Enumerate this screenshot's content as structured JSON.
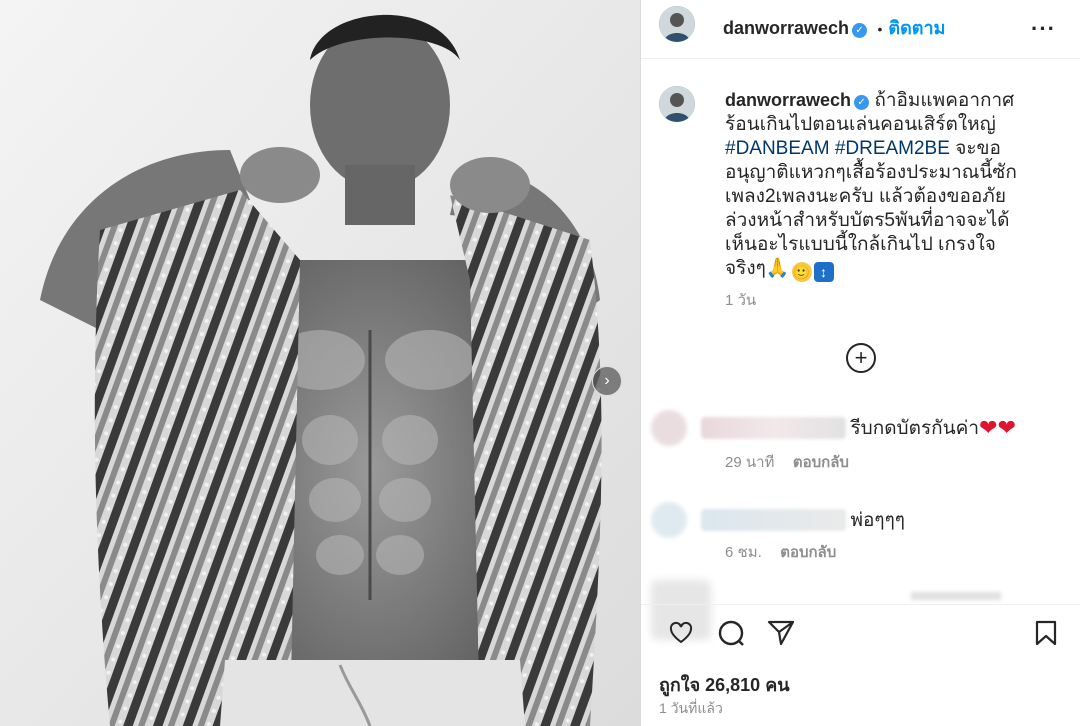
{
  "post": {
    "username": "danworrawech",
    "verified_mark": "✓",
    "separator": "•",
    "follow_label": "ติดตาม",
    "more_label": "···",
    "caption_part1": "ถ้าอิมแพคอากาศร้อนเกินไปตอนเล่นคอนเสิร์ตใหญ่",
    "hashtag1": "#DANBEAM",
    "hashtag2": "#DREAM2BE",
    "caption_part2": "จะขออนุญาติแหวกๆเสื้อร้องประมาณนี้ซักเพลง2เพลงนะครับ แล้วต้องขออภัยล่วงหน้าสำหรับบัตร5พันที่อาจจะได้เห็นอะไรแบบนี้ใกล้เกินไป เกรงใจจริงๆ",
    "emoji_pray": "🙏",
    "emoji_smile": "🙂",
    "emoji_updown": "↕",
    "caption_time": "1 วัน",
    "load_more_label": "+"
  },
  "comments": [
    {
      "text": "รีบกดบัตรกันค่า",
      "hearts": "❤❤",
      "time": "29 นาที",
      "reply_label": "ตอบกลับ"
    },
    {
      "text": "พ่อๆๆๆ",
      "time": "6 ชม.",
      "reply_label": "ตอบกลับ"
    }
  ],
  "stats": {
    "likes_text": "ถูกใจ 26,810 คน",
    "time_ago": "1 วันที่แล้ว"
  },
  "carousel": {
    "next_label": "›"
  },
  "colors": {
    "accent": "#0095f6",
    "hashtag": "#00376b",
    "heart": "#e0142e",
    "muted": "#8e8e8e"
  }
}
